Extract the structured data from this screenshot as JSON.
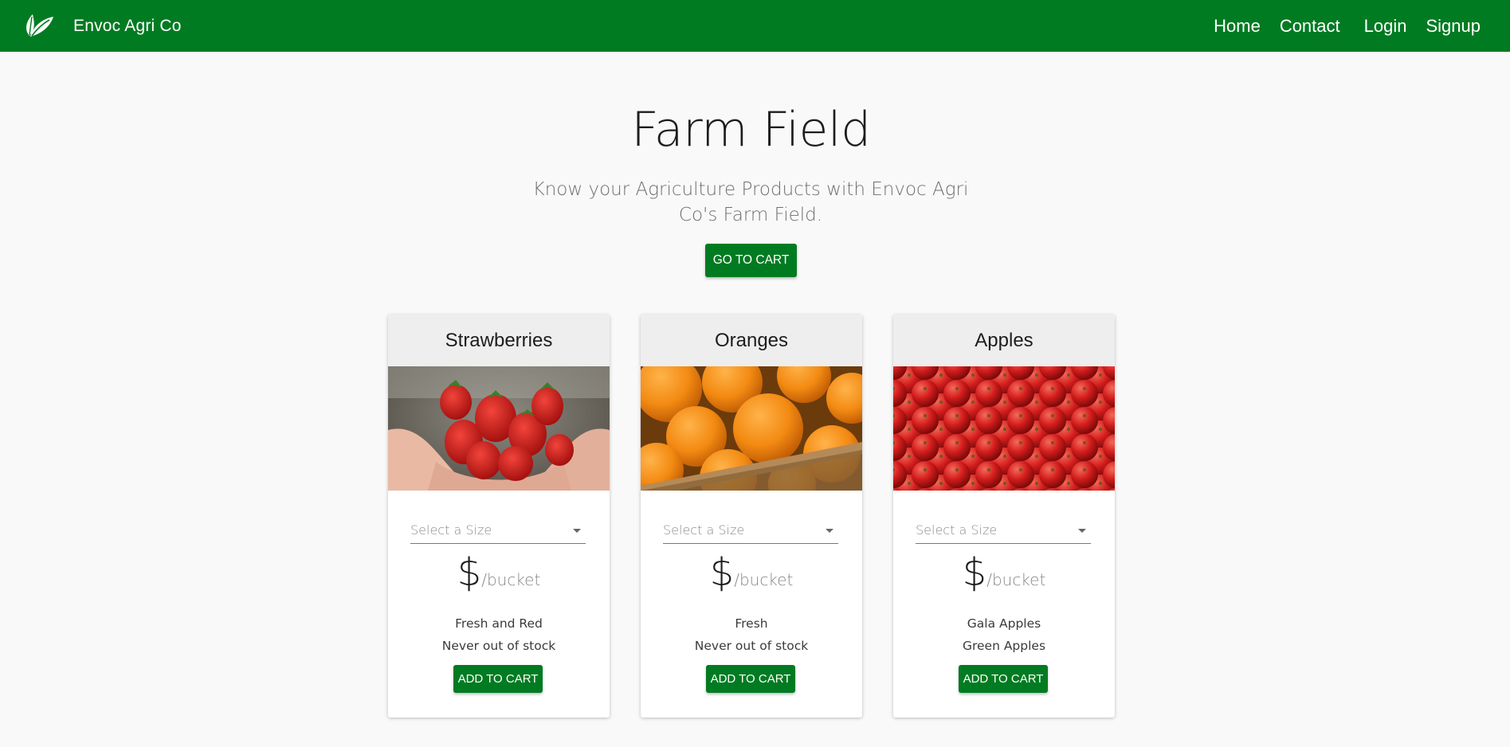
{
  "brand": {
    "name": "Envoc Agri Co",
    "logo_icon": "leaf-icon"
  },
  "nav": {
    "home": "Home",
    "contact": "Contact",
    "login": "Login",
    "signup": "Signup"
  },
  "hero": {
    "title": "Farm Field",
    "subtitle": "Know your Agriculture Products with Envoc Agri Co's Farm Field.",
    "cta": "GO TO CART"
  },
  "colors": {
    "primary_green": "#017b21",
    "card_header": "#eeeeee",
    "page_background": "#f9f9f9"
  },
  "products": [
    {
      "name": "Strawberries",
      "image": "strawberries-photo",
      "size_placeholder": "Select a Size",
      "currency": "$",
      "unit": "/bucket",
      "desc_line1": "Fresh and Red",
      "desc_line2": "Never out of stock",
      "button": "ADD TO CART"
    },
    {
      "name": "Oranges",
      "image": "oranges-photo",
      "size_placeholder": "Select a Size",
      "currency": "$",
      "unit": "/bucket",
      "desc_line1": "Fresh",
      "desc_line2": "Never out of stock",
      "button": "ADD TO CART"
    },
    {
      "name": "Apples",
      "image": "apples-photo",
      "size_placeholder": "Select a Size",
      "currency": "$",
      "unit": "/bucket",
      "desc_line1": "Gala Apples",
      "desc_line2": "Green Apples",
      "button": "ADD TO CART"
    }
  ]
}
